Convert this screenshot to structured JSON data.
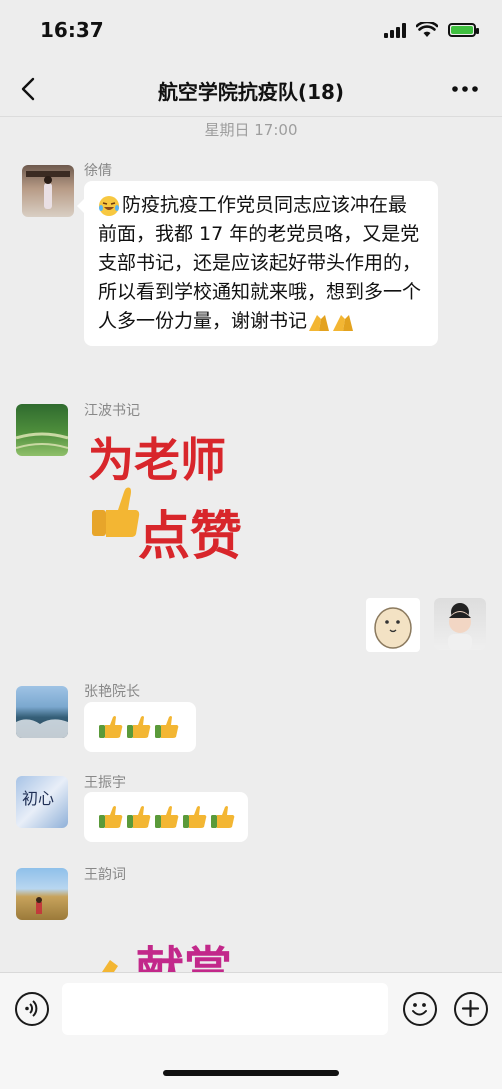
{
  "status_bar": {
    "time": "16:37"
  },
  "nav": {
    "title": "航空学院抗疫队(18)"
  },
  "timestamp": "星期日 17:00",
  "messages": [
    {
      "sender": "徐倩",
      "text": "防疫抗疫工作党员同志应该冲在最前面，我都 17 年的老党员咯，又是党支部书记，还是应该起好带头作用的，所以看到学校通知就来哦，想到多一个人多一份力量，谢谢书记"
    },
    {
      "sender": "江波书记",
      "sticker_text_1": "为老师",
      "sticker_text_2": "点赞"
    },
    {
      "sender": "张艳院长",
      "thumbs_count": 3
    },
    {
      "sender": "王振宇",
      "thumbs_count": 5,
      "avatar_text": "初心"
    },
    {
      "sender": "王韵词",
      "partial_sticker_text": "献赏"
    }
  ],
  "colors": {
    "background": "#ededed",
    "bubble": "#ffffff",
    "accent_red": "#d8262b",
    "thumbs": "#f3b633"
  },
  "icons": [
    "back-icon",
    "more-icon",
    "voice-icon",
    "emoji-icon",
    "plus-icon",
    "thumbs-up-icon"
  ]
}
